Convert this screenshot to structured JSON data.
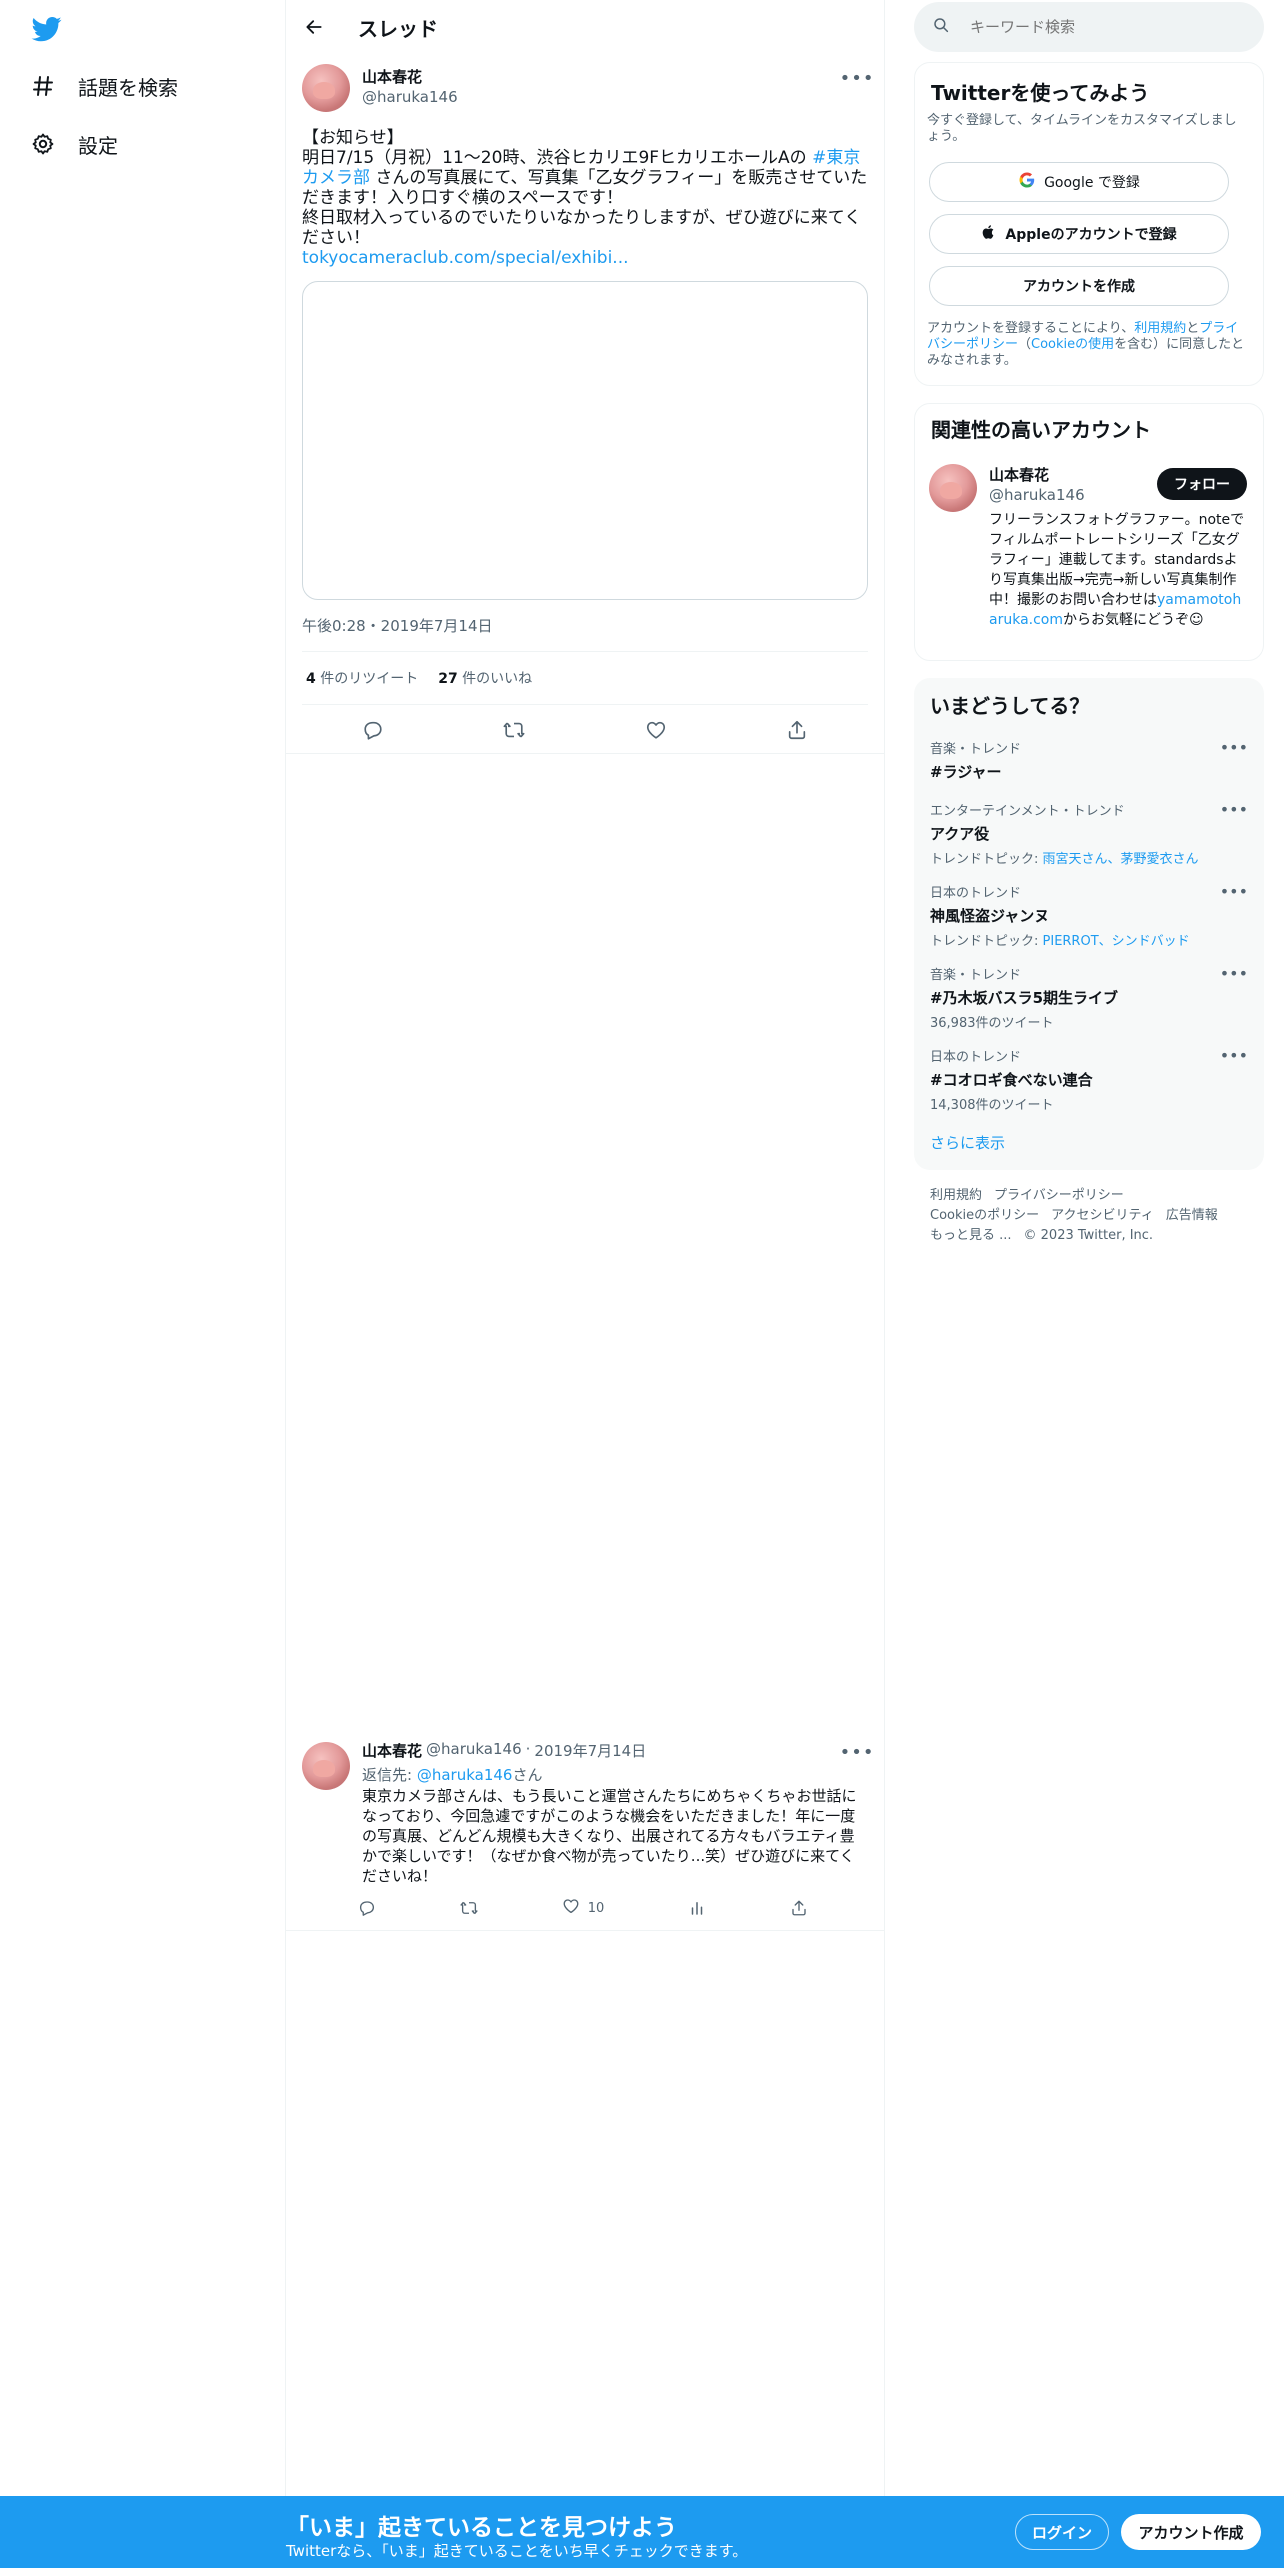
{
  "nav": {
    "items": [
      {
        "label": "話題を検索",
        "icon": "hashtag-icon"
      },
      {
        "label": "設定",
        "icon": "gear-icon"
      }
    ]
  },
  "header": {
    "title": "スレッド"
  },
  "tweet": {
    "name": "山本春花",
    "handle": "@haruka146",
    "body_prefix": "【お知らせ】\n明日7/15（月祝）11〜20時、渋谷ヒカリエ9FヒカリエホールAの ",
    "hashtag": "#東京カメラ部",
    "body_suffix": " さんの写真展にて、写真集「乙女グラフィー」を販売させていただきます！入り口すぐ横のスペースです！\n終日取材入っているのでいたりいなかったりしますが、ぜひ遊びに来てください！",
    "link": "tokyocameraclub.com/special/exhibi...",
    "timestamp": "午後0:28・2019年7月14日",
    "retweets_count": "4",
    "retweets_label": "件のリツイート",
    "likes_count": "27",
    "likes_label": "件のいいね"
  },
  "reply": {
    "name": "山本春花",
    "handle": "@haruka146",
    "dot": "·",
    "date": "2019年7月14日",
    "reply_to_label": "返信先:",
    "reply_to_handle": "@haruka146",
    "reply_to_suffix": "さん",
    "body": "東京カメラ部さんは、もう長いこと運営さんたちにめちゃくちゃお世話になっており、今回急遽ですがこのような機会をいただきました！年に一度の写真展、どんどん規模も大きくなり、出展されてる方々もバラエティ豊かで楽しいです！（なぜか食べ物が売っていたり...笑）ぜひ遊びに来てくださいね！",
    "likes": "10"
  },
  "search": {
    "placeholder": "キーワード検索"
  },
  "signup_panel": {
    "title": "Twitterを使ってみよう",
    "subtitle": "今すぐ登録して、タイムラインをカスタマイズしましょう。",
    "google": "Google で登録",
    "apple": "Appleのアカウントで登録",
    "create": "アカウントを作成",
    "legal_1": "アカウントを登録することにより、",
    "legal_terms": "利用規約",
    "legal_2": "と",
    "legal_privacy": "プライバシーポリシー",
    "legal_3": "（",
    "legal_cookie": "Cookieの使用",
    "legal_4": "を含む）に同意したとみなされます。"
  },
  "related": {
    "title": "関連性の高いアカウント",
    "name": "山本春花",
    "handle": "@haruka146",
    "follow": "フォロー",
    "bio_1": "フリーランスフォトグラファー。noteでフィルムポートレートシリーズ「乙女グラフィー」連載してます。standardsより写真集出版→完売→新しい写真集制作中！撮影のお問い合わせは",
    "bio_link": "yamamotoharuka.com",
    "bio_2": "からお気軽にどうぞ☺︎"
  },
  "trends": {
    "title": "いまどうしてる？",
    "items": [
      {
        "category": "音楽・トレンド",
        "name": "#ラジャー",
        "sub_label": "",
        "sub_links": "",
        "count": ""
      },
      {
        "category": "エンターテインメント・トレンド",
        "name": "アクア役",
        "sub_label": "トレンドトピック: ",
        "sub_links": "雨宮天さん、茅野愛衣さん",
        "count": ""
      },
      {
        "category": "日本のトレンド",
        "name": "神風怪盗ジャンヌ",
        "sub_label": "トレンドトピック: ",
        "sub_links": "PIERROT、シンドバッド",
        "count": ""
      },
      {
        "category": "音楽・トレンド",
        "name": "#乃木坂バスラ5期生ライブ",
        "sub_label": "",
        "sub_links": "",
        "count": "36,983件のツイート"
      },
      {
        "category": "日本のトレンド",
        "name": "#コオロギ食べない連合",
        "sub_label": "",
        "sub_links": "",
        "count": "14,308件のツイート"
      }
    ],
    "show_more": "さらに表示"
  },
  "footer": {
    "terms": "利用規約",
    "privacy": "プライバシーポリシー",
    "cookie": "Cookieのポリシー",
    "accessibility": "アクセシビリティ",
    "ads": "広告情報",
    "more": "もっと見る ...",
    "copyright": "© 2023 Twitter, Inc."
  },
  "bottom_bar": {
    "title": "「いま」起きていることを見つけよう",
    "subtitle": "Twitterなら、「いま」起きていることをいち早くチェックできます。",
    "login": "ログイン",
    "signup": "アカウント作成"
  },
  "colors": {
    "accent": "#1d9bf0",
    "text": "#0f1419",
    "secondary": "#536471"
  }
}
